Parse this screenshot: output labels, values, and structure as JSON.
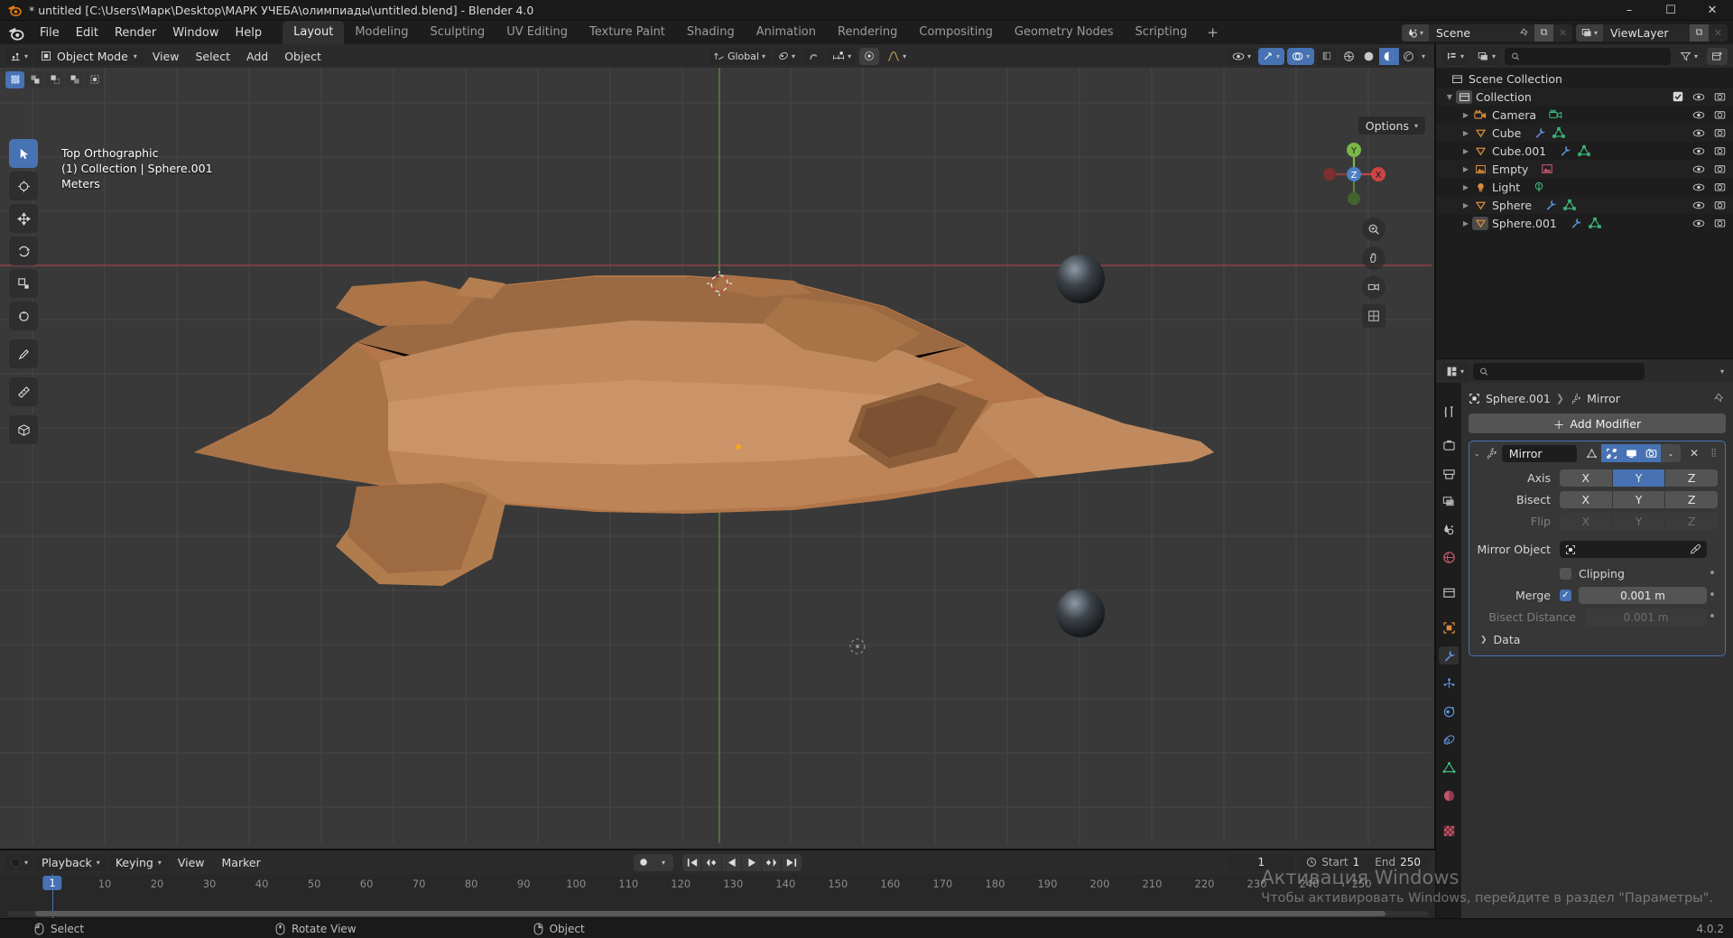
{
  "window": {
    "title": "* untitled [C:\\Users\\Марк\\Desktop\\МАРК УЧЕБА\\олимпиады\\untitled.blend] - Blender 4.0",
    "minimize": "–",
    "maximize": "☐",
    "close": "✕"
  },
  "topbar": {
    "menus": [
      "File",
      "Edit",
      "Render",
      "Window",
      "Help"
    ],
    "workspaces": [
      {
        "label": "Layout",
        "active": true
      },
      {
        "label": "Modeling",
        "active": false
      },
      {
        "label": "Sculpting",
        "active": false
      },
      {
        "label": "UV Editing",
        "active": false
      },
      {
        "label": "Texture Paint",
        "active": false
      },
      {
        "label": "Shading",
        "active": false
      },
      {
        "label": "Animation",
        "active": false
      },
      {
        "label": "Rendering",
        "active": false
      },
      {
        "label": "Compositing",
        "active": false
      },
      {
        "label": "Geometry Nodes",
        "active": false
      },
      {
        "label": "Scripting",
        "active": false
      }
    ],
    "add_workspace": "+",
    "scene": {
      "name": "Scene",
      "icon": "scene-icon",
      "new_label": "⧉",
      "remove_label": "✕"
    },
    "viewlayer": {
      "name": "ViewLayer",
      "icon": "viewlayer-icon",
      "new_label": "⧉",
      "remove_label": "✕"
    }
  },
  "viewport": {
    "mode": "Object Mode",
    "menus": [
      "View",
      "Select",
      "Add",
      "Object"
    ],
    "transform_orientation": "Global",
    "options_label": "Options",
    "overlay": {
      "line1": "Top Orthographic",
      "line2": "(1) Collection | Sphere.001",
      "line3": "Meters"
    },
    "gizmo_axes": {
      "x": "X",
      "y": "Y",
      "z": "Z"
    }
  },
  "timeline": {
    "editor_label": "Timeline",
    "playback": "Playback",
    "keying": "Keying",
    "menus": [
      "View",
      "Marker"
    ],
    "current_frame": "1",
    "start_label": "Start",
    "start_value": "1",
    "end_label": "End",
    "end_value": "250",
    "playhead_frame": "1",
    "ticks": [
      {
        "label": "10",
        "frame": 10
      },
      {
        "label": "20",
        "frame": 20
      },
      {
        "label": "30",
        "frame": 30
      },
      {
        "label": "40",
        "frame": 40
      },
      {
        "label": "50",
        "frame": 50
      },
      {
        "label": "60",
        "frame": 60
      },
      {
        "label": "70",
        "frame": 70
      },
      {
        "label": "80",
        "frame": 80
      },
      {
        "label": "90",
        "frame": 90
      },
      {
        "label": "100",
        "frame": 100
      },
      {
        "label": "110",
        "frame": 110
      },
      {
        "label": "120",
        "frame": 120
      },
      {
        "label": "130",
        "frame": 130
      },
      {
        "label": "140",
        "frame": 140
      },
      {
        "label": "150",
        "frame": 150
      },
      {
        "label": "160",
        "frame": 160
      },
      {
        "label": "170",
        "frame": 170
      },
      {
        "label": "180",
        "frame": 180
      },
      {
        "label": "190",
        "frame": 190
      },
      {
        "label": "200",
        "frame": 200
      },
      {
        "label": "210",
        "frame": 210
      },
      {
        "label": "220",
        "frame": 220
      },
      {
        "label": "230",
        "frame": 230
      },
      {
        "label": "240",
        "frame": 240
      },
      {
        "label": "250",
        "frame": 250
      }
    ]
  },
  "outliner": {
    "search_placeholder": "",
    "root": "Scene Collection",
    "collection": "Collection",
    "items": [
      {
        "label": "Camera",
        "type": "camera",
        "data_icons": [
          "camera-data"
        ],
        "selected": false
      },
      {
        "label": "Cube",
        "type": "mesh",
        "data_icons": [
          "modifier",
          "mesh-data"
        ],
        "selected": false
      },
      {
        "label": "Cube.001",
        "type": "mesh",
        "data_icons": [
          "modifier",
          "mesh-data"
        ],
        "selected": false
      },
      {
        "label": "Empty",
        "type": "image",
        "data_icons": [
          "image-data"
        ],
        "selected": false
      },
      {
        "label": "Light",
        "type": "light",
        "data_icons": [
          "light-data"
        ],
        "selected": false
      },
      {
        "label": "Sphere",
        "type": "mesh",
        "data_icons": [
          "modifier",
          "mesh-data"
        ],
        "selected": false
      },
      {
        "label": "Sphere.001",
        "type": "mesh",
        "data_icons": [
          "modifier",
          "mesh-data"
        ],
        "selected": true
      }
    ]
  },
  "properties": {
    "breadcrumb_object": "Sphere.001",
    "breadcrumb_modifier": "Mirror",
    "add_modifier": "Add Modifier",
    "modifier": {
      "name": "Mirror",
      "axis_label": "Axis",
      "axis_options": [
        "X",
        "Y",
        "Z"
      ],
      "axis_active": "Y",
      "bisect_label": "Bisect",
      "bisect_options": [
        "X",
        "Y",
        "Z"
      ],
      "flip_label": "Flip",
      "flip_options": [
        "X",
        "Y",
        "Z"
      ],
      "mirror_object_label": "Mirror Object",
      "mirror_object_value": "",
      "clipping_label": "Clipping",
      "clipping_checked": false,
      "merge_label": "Merge",
      "merge_checked": true,
      "merge_value": "0.001 m",
      "bisect_distance_label": "Bisect Distance",
      "bisect_distance_value": "0.001 m",
      "data_label": "Data"
    },
    "tabs": [
      "tool-icon",
      "render-icon",
      "output-icon",
      "viewlayer-icon",
      "scene-icon",
      "world-icon",
      "collection-icon",
      "object-icon",
      "modifier-icon",
      "particles-icon",
      "physics-icon",
      "constraints-icon",
      "data-icon",
      "material-icon",
      "texture-icon"
    ],
    "active_tab": "modifier-icon"
  },
  "statusbar": {
    "items": [
      {
        "icon": "mouse-left-icon",
        "label": "Select"
      },
      {
        "icon": "mouse-middle-icon",
        "label": "Rotate View"
      },
      {
        "icon": "mouse-right-icon",
        "label": "Object"
      }
    ],
    "version": "4.0.2"
  },
  "watermark": {
    "line1": "Активация Windows",
    "line2": "Чтобы активировать Windows, перейдите в раздел \"Параметры\"."
  },
  "colors": {
    "accent": "#4772b3",
    "panel": "#303030",
    "viewport_bg": "#393939",
    "mesh_orange": "#c08050",
    "axis_x_red": "#cc4444",
    "axis_y_green": "#7ab648"
  }
}
